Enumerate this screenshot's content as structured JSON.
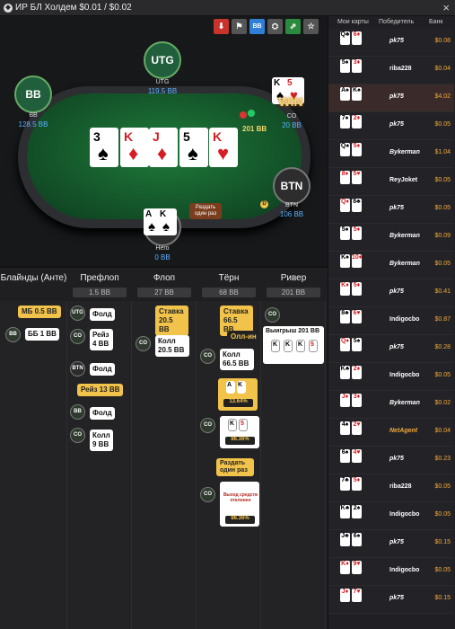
{
  "title": "ИР БЛ Холдем $0.01 / $0.02",
  "toolbar": {
    "colors": [
      "#d53a2a",
      "#555",
      "#2f7fd6",
      "#555",
      "#2b8a3e",
      "#555"
    ]
  },
  "table": {
    "utg": {
      "seat": "UTG",
      "name": "UTG",
      "stack": "119.5 BB"
    },
    "bb": {
      "seat": "BB",
      "name": "BB",
      "stack": "128.5 BB"
    },
    "co": {
      "name": "CO",
      "stack": "20 BB",
      "win": "WIN",
      "chips": "201 BB"
    },
    "btn": {
      "seat": "BTN",
      "name": "BTN",
      "stack": "106 BB",
      "dealer": "D"
    },
    "hero": {
      "name": "Hero",
      "stack": "0 BB",
      "bubble": "Раздать один раз"
    },
    "board": [
      {
        "r": "3",
        "s": "♠",
        "c": "blk"
      },
      {
        "r": "K",
        "s": "♦",
        "c": "red"
      },
      {
        "r": "J",
        "s": "♦",
        "c": "red"
      },
      {
        "r": "5",
        "s": "♠",
        "c": "blk"
      },
      {
        "r": "K",
        "s": "♥",
        "c": "red"
      }
    ],
    "hero_cards": [
      {
        "r": "A",
        "s": "♠"
      },
      {
        "r": "K",
        "s": "♠"
      }
    ],
    "co_cards": [
      {
        "r": "K",
        "s": "♠"
      },
      {
        "r": "5",
        "s": "♥"
      }
    ]
  },
  "streets": [
    {
      "name": "Блайнды (Анте)",
      "pot": ""
    },
    {
      "name": "Префлоп",
      "pot": "1.5 BB"
    },
    {
      "name": "Флоп",
      "pot": "27 BB"
    },
    {
      "name": "Тёрн",
      "pot": "68 BB"
    },
    {
      "name": "Ривер",
      "pot": "201 BB"
    }
  ],
  "actions": {
    "mb": "МБ 0.5 BB",
    "bb_seat": "BB",
    "bb": "ББ 1 BB",
    "utg_seat": "UTG",
    "utg_fold": "Фолд",
    "co_seat": "CO",
    "co_raise": "Рейз 4 BB",
    "btn_seat": "BTN",
    "btn_fold": "Фолд",
    "hero_raise": "Рейз 13 BB",
    "bb_fold": "Фолд",
    "co_call9": "Колл 9 BB",
    "flop_bet": "Ставка 20.5 BB",
    "flop_call": "Колл 20.5 BB",
    "turn_bet": "Ставка 66.5 BB",
    "allin": "Олл-ин",
    "turn_call": "Колл 66.5 BB",
    "pct1": "13.64%",
    "pct2": "86.36%",
    "run_once": "Раздать один раз",
    "deal_text": "Выход средств отклонен",
    "pct3": "86.36%",
    "river_win": "Выигрыш 201 BB"
  },
  "side": {
    "headers": [
      "Мои карты",
      "Победитель",
      "Банк"
    ],
    "rows": [
      {
        "c1": "Q♣",
        "c2": "6♦",
        "w": "pk75",
        "b": "$0.08",
        "it": true
      },
      {
        "c1": "5♠",
        "c2": "3♦",
        "w": "riba228",
        "b": "$0.04",
        "it": false
      },
      {
        "c1": "A♠",
        "c2": "K♠",
        "w": "pk75",
        "b": "$4.02",
        "it": true
      },
      {
        "c1": "7♠",
        "c2": "2♦",
        "w": "pk75",
        "b": "$0.05",
        "it": true
      },
      {
        "c1": "Q♠",
        "c2": "5♦",
        "w": "Bykerman",
        "b": "$1.04",
        "it": false
      },
      {
        "c1": "8♦",
        "c2": "5♥",
        "w": "ReyJoket",
        "b": "$0.05",
        "it": false
      },
      {
        "c1": "Q♦",
        "c2": "8♣",
        "w": "pk75",
        "b": "$0.05",
        "it": true
      },
      {
        "c1": "5♠",
        "c2": "5♦",
        "w": "Bykerman",
        "b": "$0.09",
        "it": false
      },
      {
        "c1": "K♠",
        "c2": "10♦",
        "w": "Bykerman",
        "b": "$0.05",
        "it": false
      },
      {
        "c1": "K♦",
        "c2": "5♦",
        "w": "pk75",
        "b": "$0.41",
        "it": true
      },
      {
        "c1": "8♣",
        "c2": "6♥",
        "w": "Indigocbo",
        "b": "$0.87",
        "it": false
      },
      {
        "c1": "Q♦",
        "c2": "5♠",
        "w": "pk75",
        "b": "$0.28",
        "it": true
      },
      {
        "c1": "K♣",
        "c2": "2♦",
        "w": "Indigocbo",
        "b": "$0.05",
        "it": false
      },
      {
        "c1": "J♦",
        "c2": "3♦",
        "w": "Bykerman",
        "b": "$0.02",
        "it": true
      },
      {
        "c1": "4♠",
        "c2": "2♥",
        "w": "NetAgent",
        "b": "$0.04",
        "it": true
      },
      {
        "c1": "6♠",
        "c2": "4♥",
        "w": "pk75",
        "b": "$0.23",
        "it": true
      },
      {
        "c1": "7♣",
        "c2": "5♦",
        "w": "riba228",
        "b": "$0.05",
        "it": false
      },
      {
        "c1": "K♣",
        "c2": "2♠",
        "w": "Indigocbo",
        "b": "$0.05",
        "it": false
      },
      {
        "c1": "J♣",
        "c2": "6♠",
        "w": "pk75",
        "b": "$0.15",
        "it": true
      },
      {
        "c1": "K♦",
        "c2": "9♥",
        "w": "Indigocbo",
        "b": "$0.05",
        "it": false
      },
      {
        "c1": "J♦",
        "c2": "7♥",
        "w": "pk75",
        "b": "$0.15",
        "it": true
      }
    ]
  }
}
